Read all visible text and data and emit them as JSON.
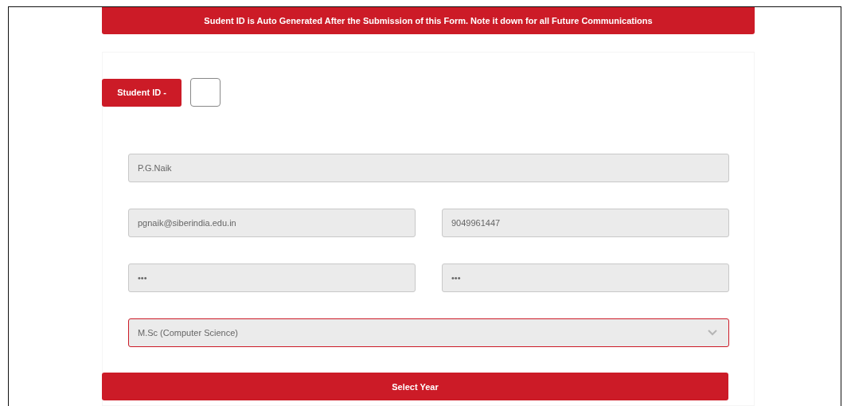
{
  "notice": "Sudent ID is Auto Generated After the Submission of this Form. Note it down for all Future Communications",
  "student_id": {
    "label": "Student ID -"
  },
  "fields": [
    {
      "value": "P.G.Naik",
      "wide": true
    },
    {
      "value": "pgnaik@siberindia.edu.in",
      "wide": false
    },
    {
      "value": "9049961447",
      "wide": false
    },
    {
      "value": "•••",
      "wide": false
    },
    {
      "value": "•••",
      "wide": false
    }
  ],
  "course_select": {
    "value": "M.Sc (Computer Science)",
    "focused": true
  },
  "year_button": {
    "label": "Select Year"
  }
}
